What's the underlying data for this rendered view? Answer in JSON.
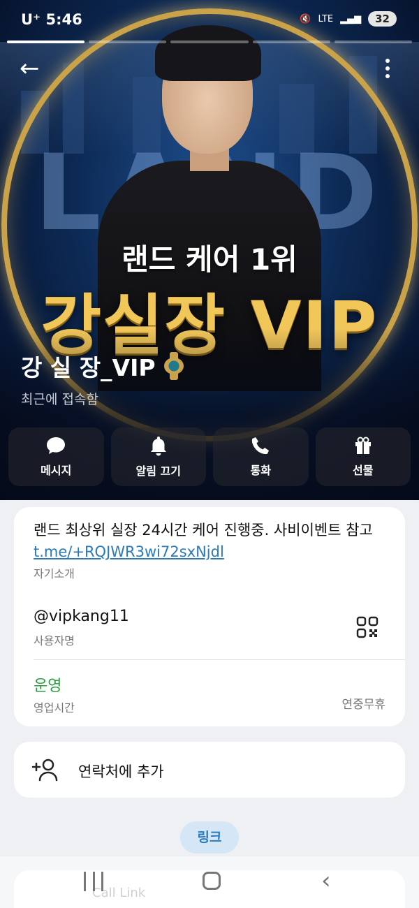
{
  "status_bar": {
    "carrier": "U⁺",
    "time": "5:46",
    "network": "LTE",
    "battery": "32"
  },
  "hero": {
    "background_word": "LAND",
    "tagline_small": "랜드 케어 1위",
    "tagline_big": "강실장 VIP"
  },
  "profile": {
    "name": "강 실 장_VIP",
    "last_seen": "최근에 접속함"
  },
  "actions": [
    {
      "label": "메시지",
      "icon": "message-icon"
    },
    {
      "label": "알림 끄기",
      "icon": "bell-icon"
    },
    {
      "label": "통화",
      "icon": "phone-icon"
    },
    {
      "label": "선물",
      "icon": "gift-icon"
    }
  ],
  "info": {
    "bio_text": "랜드 최상위 실장 24시간 케어 진행중. 사비이벤트 참고 ",
    "bio_link": "t.me/+RQJWR3wi72sxNjdl",
    "bio_caption": "자기소개",
    "username": "@vipkang11",
    "username_caption": "사용자명",
    "hours_status": "운영",
    "hours_caption": "영업시간",
    "hours_note": "연중무휴"
  },
  "add_contact": {
    "label": "연락처에 추가"
  },
  "links_chip": "링크",
  "call_link": "Call Link",
  "colors": {
    "accent": "#2b7bbd",
    "open_green": "#2d9e3f",
    "gold": "#f2c75a"
  }
}
